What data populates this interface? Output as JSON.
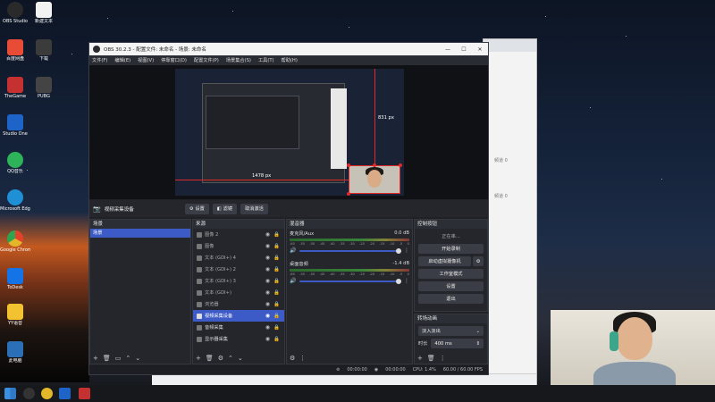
{
  "desktop": {
    "icons": [
      {
        "label": "OBS Studio",
        "icon": "obs-icon",
        "color": "#2a2a2a"
      },
      {
        "label": "新建文本",
        "icon": "document-icon",
        "color": "#f2f2f2"
      },
      {
        "label": "百度网盘",
        "icon": "cloud-icon",
        "color": "#e94c36"
      },
      {
        "label": "下载",
        "icon": "download-icon",
        "color": "#3b3b3b"
      },
      {
        "label": "TheGame",
        "icon": "game-icon",
        "color": "#c53030"
      },
      {
        "label": "PUBG",
        "icon": "game-icon",
        "color": "#444"
      },
      {
        "label": "Studio One",
        "icon": "studio-icon",
        "color": "#1e64c8"
      },
      {
        "label": "QQ音乐",
        "icon": "music-icon",
        "color": "#2fb35a"
      },
      {
        "label": "Microsoft Edge",
        "icon": "edge-icon",
        "color": "#1f8fd6"
      },
      {
        "label": "Google Chrome",
        "icon": "chrome-icon",
        "color": "#e4b62a"
      },
      {
        "label": "ToDesk",
        "icon": "todesk-icon",
        "color": "#1473e6"
      },
      {
        "label": "YY语音",
        "icon": "yy-icon",
        "color": "#f2c230"
      },
      {
        "label": "此电脑",
        "icon": "computer-icon",
        "color": "#2b6fb7"
      }
    ]
  },
  "obs": {
    "title": "OBS 30.2.3 - 配置文件: 未命名 - 场景: 未命名",
    "window_controls": [
      "—",
      "☐",
      "✕"
    ],
    "menu": [
      "文件(F)",
      "编辑(E)",
      "视图(V)",
      "停靠窗口(D)",
      "配置文件(P)",
      "场景集合(S)",
      "工具(T)",
      "帮助(H)"
    ],
    "preview": {
      "measure_vertical": "831 px",
      "measure_horizontal": "1478 px"
    },
    "source_bar": {
      "source_name": "视频采集设备",
      "settings": "设置",
      "filters": "滤镜",
      "deactivate": "取消激活"
    },
    "scenes": {
      "header": "场景",
      "items": [
        "场景"
      ]
    },
    "sources": {
      "header": "来源",
      "items": [
        {
          "label": "图像 2",
          "active": false
        },
        {
          "label": "图像",
          "active": false
        },
        {
          "label": "文本 (GDI+) 4",
          "active": false
        },
        {
          "label": "文本 (GDI+) 2",
          "active": false
        },
        {
          "label": "文本 (GDI+) 3",
          "active": false
        },
        {
          "label": "文本 (GDI+)",
          "active": false
        },
        {
          "label": "浏览器",
          "active": false
        },
        {
          "label": "视频采集设备",
          "active": true
        },
        {
          "label": "音频采集",
          "active": false
        },
        {
          "label": "显示器采集",
          "active": false
        }
      ]
    },
    "mixer": {
      "header": "混音器",
      "channels": [
        {
          "name": "麦克风/Aux",
          "db": "0.0 dB"
        },
        {
          "name": "桌面音频",
          "db": "-1.4 dB"
        }
      ],
      "ticks": [
        "-60",
        "-55",
        "-50",
        "-45",
        "-40",
        "-35",
        "-30",
        "-25",
        "-20",
        "-15",
        "-10",
        "-5",
        "0"
      ]
    },
    "controls": {
      "header": "控制按钮",
      "status": "正在串...",
      "buttons": [
        "开始录制",
        "启动虚拟摄像机",
        "工作室模式",
        "设置",
        "退出"
      ]
    },
    "transitions": {
      "header": "转场动画",
      "type": "淡入淡出",
      "duration_label": "时长",
      "duration": "400 ms"
    },
    "status": {
      "rec_time": "00:00:00",
      "stream_time": "00:00:00",
      "cpu": "CPU: 1.4%",
      "fps": "60.00 / 60.00 FPS"
    }
  },
  "browser": {
    "snippets": [
      "频道 0",
      "频道 0"
    ]
  }
}
